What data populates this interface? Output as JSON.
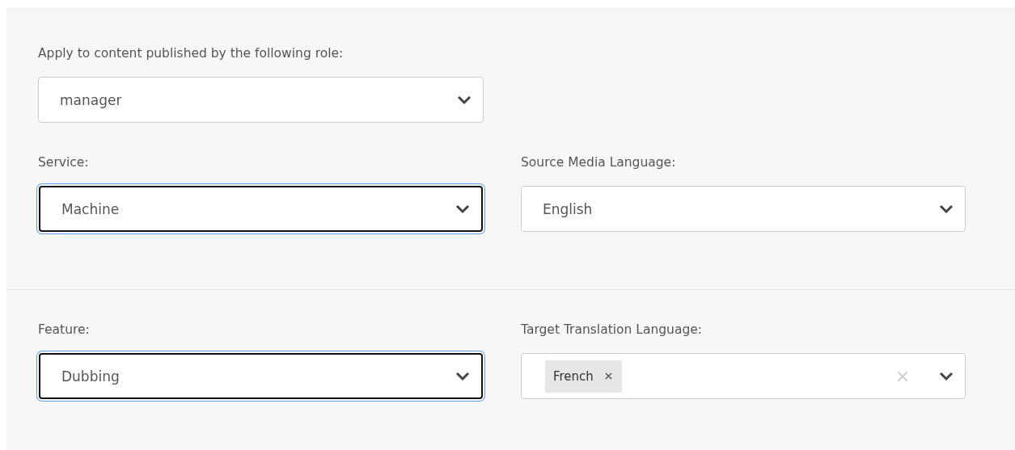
{
  "sections": [
    {
      "fields": [
        {
          "kind": "select",
          "label": "Apply to content published by the following role:",
          "value": "manager",
          "focused": false
        }
      ]
    },
    {
      "fields": [
        {
          "kind": "select",
          "label": "Service:",
          "value": "Machine",
          "focused": true
        },
        {
          "kind": "select",
          "label": "Source Media Language:",
          "value": "English",
          "focused": false
        }
      ]
    },
    {
      "fields": [
        {
          "kind": "select",
          "label": "Feature:",
          "value": "Dubbing",
          "focused": true
        },
        {
          "kind": "multiselect",
          "label": "Target Translation Language:",
          "tags": [
            "French"
          ],
          "focused": false
        }
      ]
    }
  ]
}
